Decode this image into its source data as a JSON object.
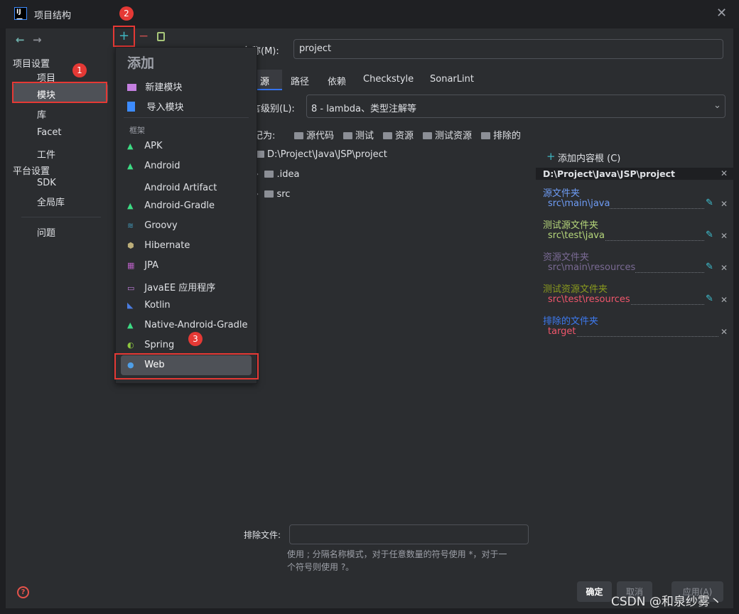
{
  "window": {
    "title": "项目结构",
    "close_icon": "close-icon"
  },
  "nav": {
    "back": "←",
    "forward": "→"
  },
  "sidebar": {
    "project_settings": "项目设置",
    "items": [
      "项目",
      "模块",
      "库",
      "Facet",
      "工件"
    ],
    "platform_settings": "平台设置",
    "platform_items": [
      "SDK",
      "全局库"
    ],
    "problems": "问题",
    "selected": "模块"
  },
  "toolbar": {
    "add": "+",
    "remove": "−",
    "copy": "copy-icon"
  },
  "popup": {
    "title": "添加",
    "actions": [
      "新建模块",
      "导入模块"
    ],
    "framework_header": "框架",
    "frameworks": [
      "APK",
      "Android",
      "Android Artifact",
      "Android-Gradle",
      "Groovy",
      "Hibernate",
      "JPA",
      "JavaEE 应用程序",
      "Kotlin",
      "Native-Android-Gradle",
      "Spring",
      "Web"
    ],
    "selected": "Web"
  },
  "annotations": [
    "1",
    "2",
    "3"
  ],
  "main": {
    "name_label": "名称(M):",
    "name_value": "project",
    "tabs": [
      "源",
      "路径",
      "依赖",
      "Checkstyle",
      "SonarLint"
    ],
    "active_tab": "源",
    "lang_label": "语言级别(L):",
    "lang_value": "8 - lambda、类型注解等",
    "mark_label": "标记为:",
    "mark_items": [
      "源代码",
      "测试",
      "资源",
      "测试资源",
      "排除的"
    ],
    "tree": {
      "root": "D:\\Project\\Java\\JSP\\project",
      "children": [
        ".idea",
        "src"
      ]
    },
    "exclude_label": "排除文件:",
    "exclude_value": "",
    "hint_line1": "使用 ; 分隔名称模式，对于任意数量的符号使用 *，对于一",
    "hint_line2": "个符号则使用 ?。"
  },
  "content_root": {
    "add_label": "添加内容根 (C)",
    "path": "D:\\Project\\Java\\JSP\\project",
    "groups": [
      {
        "title": "源文件夹",
        "path": "src\\main\\java",
        "color": "#6e9cf5",
        "path_color": "#6e9cf5",
        "editable": true
      },
      {
        "title": "测试源文件夹",
        "path": "src\\test\\java",
        "color": "#b5d67a",
        "path_color": "#b5d67a",
        "editable": true
      },
      {
        "title": "资源文件夹",
        "path": "src\\main\\resources",
        "color": "#7a6a94",
        "path_color": "#7a6a94",
        "editable": true
      },
      {
        "title": "测试资源文件夹",
        "path": "src\\test\\resources",
        "color": "#8a9a1e",
        "path_color": "#f0566b",
        "editable": true
      },
      {
        "title": "排除的文件夹",
        "path": "target",
        "color": "#3d7af0",
        "path_color": "#f0566b",
        "editable": false
      }
    ]
  },
  "buttons": {
    "ok": "确定",
    "cancel": "取消",
    "apply": "应用(A)"
  },
  "watermark": "CSDN @和泉纱雾丶"
}
